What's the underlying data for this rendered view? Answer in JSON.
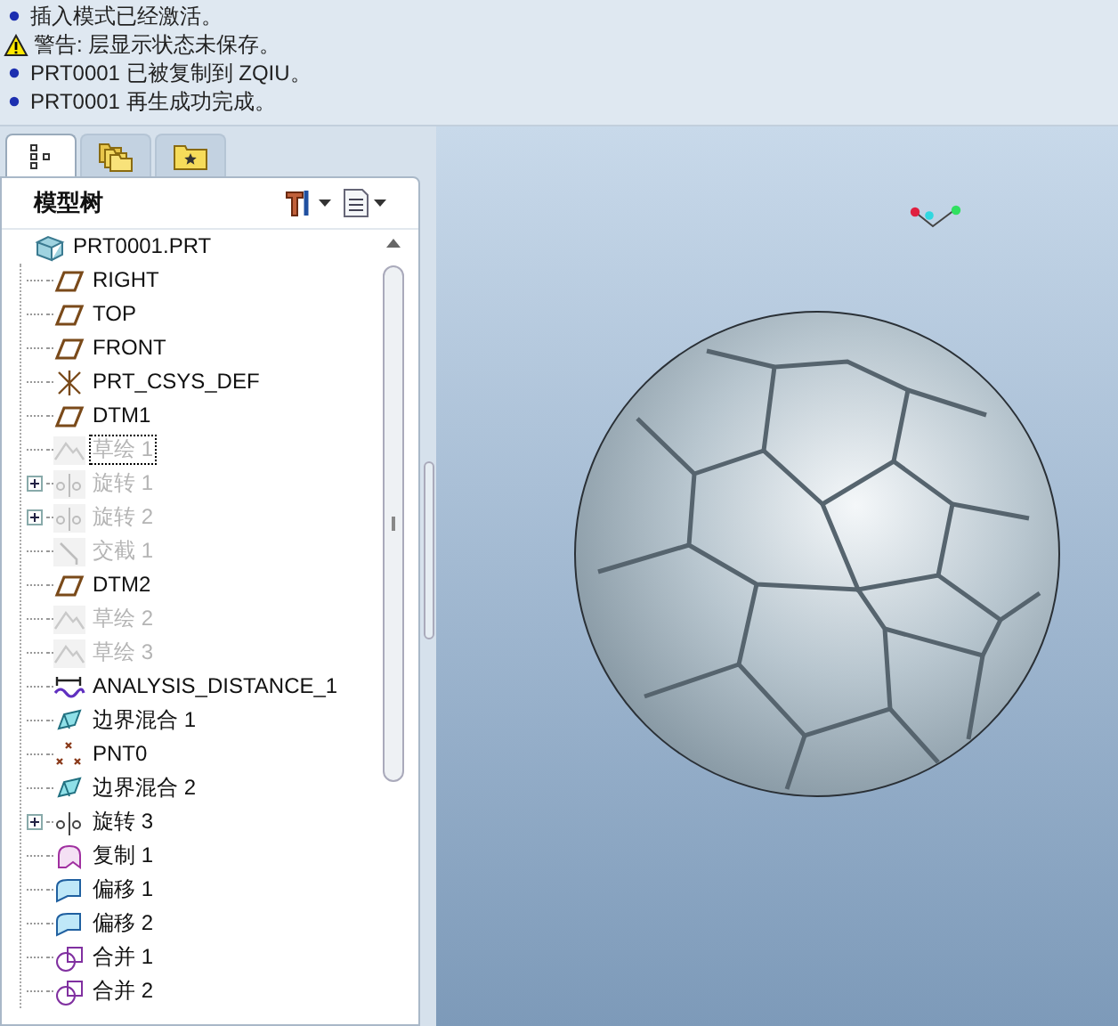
{
  "messages": [
    {
      "kind": "info",
      "text": "插入模式已经激活。"
    },
    {
      "kind": "warning",
      "text": "警告: 层显示状态未保存。"
    },
    {
      "kind": "info",
      "text": "PRT0001 已被复制到 ZQIU。"
    },
    {
      "kind": "info",
      "text": "PRT0001 再生成功完成。"
    }
  ],
  "navigator_tabs": [
    {
      "kind": "tree",
      "selected": true
    },
    {
      "kind": "folders",
      "selected": false
    },
    {
      "kind": "favorites",
      "selected": false
    }
  ],
  "model_tree": {
    "title": "模型树",
    "root": {
      "kind": "part",
      "label": "PRT0001.PRT",
      "children": [
        {
          "kind": "plane",
          "label": "RIGHT",
          "disabled": false,
          "collapsed": false,
          "selected": false
        },
        {
          "kind": "plane",
          "label": "TOP",
          "disabled": false,
          "collapsed": false,
          "selected": false
        },
        {
          "kind": "plane",
          "label": "FRONT",
          "disabled": false,
          "collapsed": false,
          "selected": false
        },
        {
          "kind": "csys",
          "label": "PRT_CSYS_DEF",
          "disabled": false,
          "collapsed": false,
          "selected": false
        },
        {
          "kind": "plane",
          "label": "DTM1",
          "disabled": false,
          "collapsed": false,
          "selected": false
        },
        {
          "kind": "sketch",
          "label": "草绘 1",
          "disabled": true,
          "collapsed": false,
          "selected": true
        },
        {
          "kind": "revolve",
          "label": "旋转 1",
          "disabled": true,
          "collapsed": true,
          "selected": false
        },
        {
          "kind": "revolve",
          "label": "旋转 2",
          "disabled": true,
          "collapsed": true,
          "selected": false
        },
        {
          "kind": "intersect",
          "label": "交截 1",
          "disabled": true,
          "collapsed": false,
          "selected": false
        },
        {
          "kind": "plane",
          "label": "DTM2",
          "disabled": false,
          "collapsed": false,
          "selected": false
        },
        {
          "kind": "sketch",
          "label": "草绘 2",
          "disabled": true,
          "collapsed": false,
          "selected": false
        },
        {
          "kind": "sketch",
          "label": "草绘 3",
          "disabled": true,
          "collapsed": false,
          "selected": false
        },
        {
          "kind": "analysis",
          "label": "ANALYSIS_DISTANCE_1",
          "disabled": false,
          "collapsed": false,
          "selected": false
        },
        {
          "kind": "boundary",
          "label": "边界混合 1",
          "disabled": false,
          "collapsed": false,
          "selected": false
        },
        {
          "kind": "point",
          "label": "PNT0",
          "disabled": false,
          "collapsed": false,
          "selected": false
        },
        {
          "kind": "boundary",
          "label": "边界混合 2",
          "disabled": false,
          "collapsed": false,
          "selected": false
        },
        {
          "kind": "revolve",
          "label": "旋转 3",
          "disabled": false,
          "collapsed": true,
          "selected": false
        },
        {
          "kind": "copy",
          "label": "复制 1",
          "disabled": false,
          "collapsed": false,
          "selected": false
        },
        {
          "kind": "offset",
          "label": "偏移 1",
          "disabled": false,
          "collapsed": false,
          "selected": false
        },
        {
          "kind": "offset",
          "label": "偏移 2",
          "disabled": false,
          "collapsed": false,
          "selected": false
        },
        {
          "kind": "merge",
          "label": "合并 1",
          "disabled": false,
          "collapsed": false,
          "selected": false
        },
        {
          "kind": "merge",
          "label": "合并 2",
          "disabled": false,
          "collapsed": false,
          "selected": false
        }
      ]
    }
  }
}
